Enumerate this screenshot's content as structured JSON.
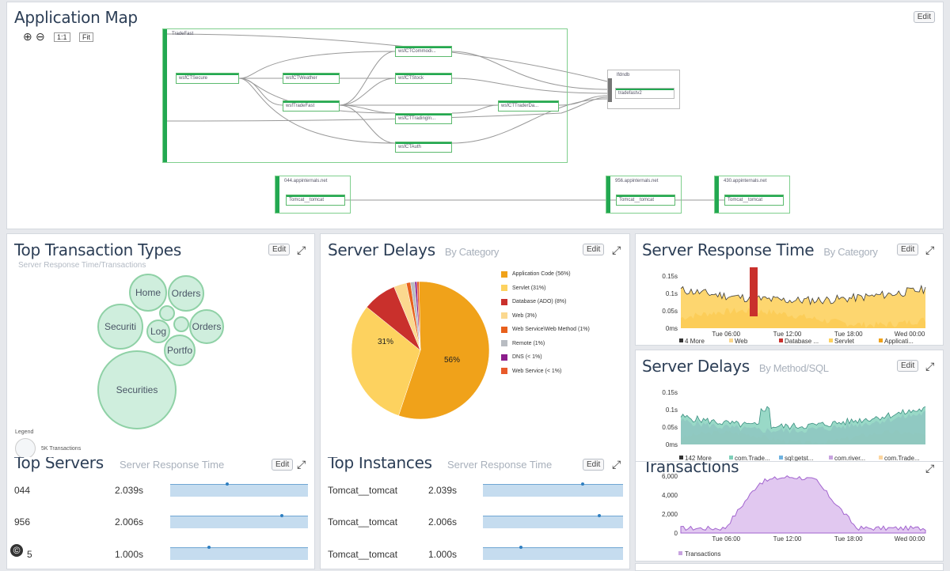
{
  "app_map": {
    "title": "Application Map",
    "edit": "Edit",
    "zoom_in": "⊕",
    "zoom_out": "⊖",
    "one_to_one": "1:1",
    "fit": "Fit",
    "group_main": "TradeFast",
    "nodes": {
      "secure": "wsfCTSecure",
      "weather": "wsfCTWeather",
      "tradefast": "wsfTradeFast",
      "commod": "wsfCTCommodi...",
      "stock": "wsfCTStock",
      "trading": "wsfCTTradingIn...",
      "auth": "wsfCTAuth",
      "traderda": "wsfCTTraderDa...",
      "db_group": "lfdndb",
      "db": "tradefastv2"
    },
    "hosts": [
      {
        "host": "044.appinternals.net",
        "app": "Tomcat__tomcat"
      },
      {
        "host": "956.appinternals.net",
        "app": "Tomcat__tomcat"
      },
      {
        "host": "430.appinternals.net",
        "app": "Tomcat__tomcat"
      }
    ]
  },
  "top_tx": {
    "title": "Top Transaction Types",
    "subtitle": "Server Response Time/Transactions",
    "edit": "Edit",
    "bubbles": [
      "Home",
      "Orders",
      "Securiti",
      "Log",
      "Orders",
      "Portfo",
      "Securities"
    ],
    "legend_title": "Legend",
    "legend_text": "5K Transactions"
  },
  "server_delays": {
    "title": "Server Delays",
    "subtitle": "By Category",
    "edit": "Edit",
    "legend": [
      {
        "label": "Application Code (56%)",
        "color": "#f0a21a"
      },
      {
        "label": "Servlet (31%)",
        "color": "#fdd25f"
      },
      {
        "label": "Database (ADO) (8%)",
        "color": "#c9302c"
      },
      {
        "label": "Web (3%)",
        "color": "#fbd88f"
      },
      {
        "label": "Web Service\\Web Method (1%)",
        "color": "#e8601c"
      },
      {
        "label": "Remote (1%)",
        "color": "#b8bcc2"
      },
      {
        "label": "DNS (< 1%)",
        "color": "#8b1d8b"
      },
      {
        "label": "Web Service (< 1%)",
        "color": "#e85a2a"
      }
    ],
    "pie_labels": {
      "big": "56%",
      "small": "31%"
    }
  },
  "chart_data": [
    {
      "type": "pie",
      "title": "Server Delays",
      "categories": [
        "Application Code",
        "Servlet",
        "Database (ADO)",
        "Web",
        "Web Service\\Web Method",
        "Remote",
        "DNS",
        "Web Service"
      ],
      "values": [
        56,
        31,
        8,
        3,
        1,
        1,
        0.5,
        0.5
      ]
    },
    {
      "type": "area",
      "title": "Server Response Time",
      "x": [
        "Tue 06:00",
        "Tue 12:00",
        "Tue 18:00",
        "Wed 00:00"
      ],
      "ylabels": [
        "0ms",
        "0.05s",
        "0.1s",
        "0.15s"
      ],
      "series": [
        {
          "name": "4 More"
        },
        {
          "name": "Web"
        },
        {
          "name": "Database ..."
        },
        {
          "name": "Servlet"
        },
        {
          "name": "Applicati..."
        }
      ]
    },
    {
      "type": "area",
      "title": "Server Delays",
      "x": [
        "Tue 06:00",
        "Tue 12:00",
        "Tue 18:00",
        "Wed 00:00"
      ],
      "ylabels": [
        "0ms",
        "0.05s",
        "0.1s",
        "0.15s"
      ],
      "series": [
        {
          "name": "142 More"
        },
        {
          "name": "com.Trade..."
        },
        {
          "name": "sql:getst..."
        },
        {
          "name": "com.river..."
        },
        {
          "name": "com.Trade..."
        }
      ]
    },
    {
      "type": "area",
      "title": "Transactions",
      "x": [
        "Tue 06:00",
        "Tue 12:00",
        "Tue 18:00",
        "Wed 00:00"
      ],
      "ylabels": [
        "0",
        "2,000",
        "4,000",
        "6,000"
      ],
      "series": [
        {
          "name": "Transactions"
        }
      ]
    }
  ],
  "resp_time": {
    "title": "Server Response Time",
    "subtitle": "By Category",
    "edit": "Edit",
    "yticks": [
      "0.15s",
      "0.1s",
      "0.05s",
      "0ms"
    ],
    "xticks": [
      "Tue 06:00",
      "Tue 12:00",
      "Tue 18:00",
      "Wed 00:00"
    ],
    "legend": [
      {
        "label": "4 More",
        "color": "#333333"
      },
      {
        "label": "Web",
        "color": "#fbd88f"
      },
      {
        "label": "Database ...",
        "color": "#c9302c"
      },
      {
        "label": "Servlet",
        "color": "#fdd25f"
      },
      {
        "label": "Applicati...",
        "color": "#f0a21a"
      }
    ]
  },
  "delays_method": {
    "title": "Server Delays",
    "subtitle": "By Method/SQL",
    "edit": "Edit",
    "yticks": [
      "0.15s",
      "0.1s",
      "0.05s",
      "0ms"
    ],
    "xticks": [
      "Tue 06:00",
      "Tue 12:00",
      "Tue 18:00",
      "Wed 00:00"
    ],
    "legend": [
      {
        "label": "142 More",
        "color": "#333333"
      },
      {
        "label": "com.Trade...",
        "color": "#7fcfb9"
      },
      {
        "label": "sql:getst...",
        "color": "#6fb3e0"
      },
      {
        "label": "com.river...",
        "color": "#c8a3e0"
      },
      {
        "label": "com.Trade...",
        "color": "#fcd6a0"
      }
    ]
  },
  "transactions": {
    "title": "Transactions",
    "yticks": [
      "6,000",
      "4,000",
      "2,000",
      "0"
    ],
    "xticks": [
      "Tue 06:00",
      "Tue 12:00",
      "Tue 18:00",
      "Wed 00:00"
    ],
    "legend": "Transactions"
  },
  "top_servers": {
    "title": "Top Servers",
    "subtitle": "Server Response Time",
    "edit": "Edit",
    "rows": [
      {
        "name": "044",
        "value": "2.039s",
        "dot": 0.4
      },
      {
        "name": "956",
        "value": "2.006s",
        "dot": 0.8
      },
      {
        "name": "5",
        "value": "1.000s",
        "dot": 0.27
      }
    ]
  },
  "top_instances": {
    "title": "Top Instances",
    "subtitle": "Server Response Time",
    "edit": "Edit",
    "rows": [
      {
        "name": "Tomcat__tomcat",
        "value": "2.039s",
        "dot": 0.7
      },
      {
        "name": "Tomcat__tomcat",
        "value": "2.006s",
        "dot": 0.82
      },
      {
        "name": "Tomcat__tomcat",
        "value": "1.000s",
        "dot": 0.26
      }
    ]
  },
  "copyright": "©"
}
